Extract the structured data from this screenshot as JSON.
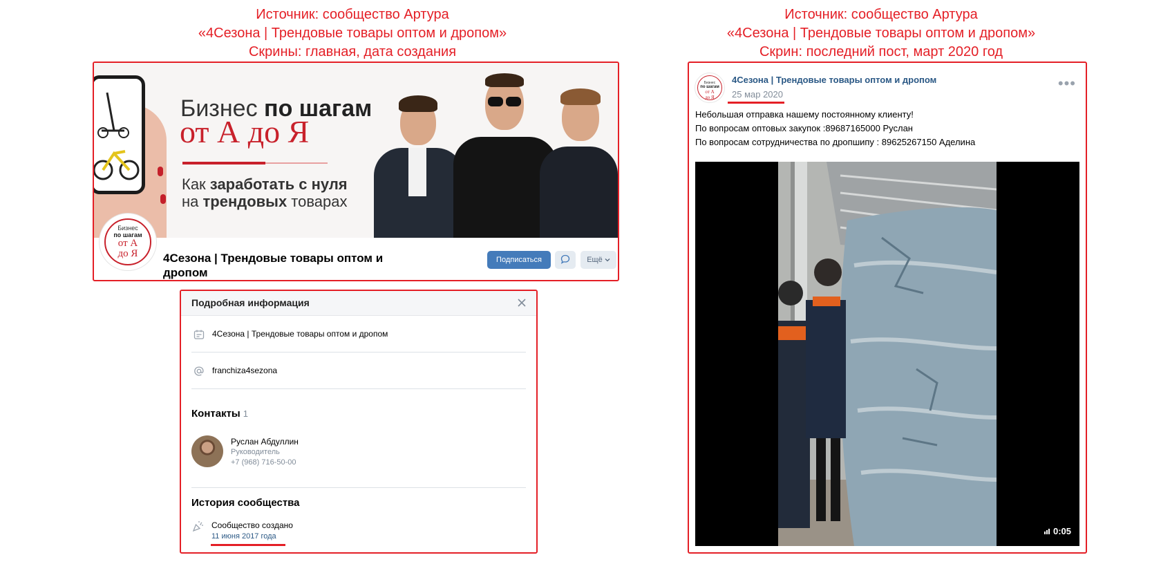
{
  "captions": {
    "left": [
      "Источник: сообщество Артура",
      "«4Сезона | Трендовые товары оптом и дропом»",
      "Скрины: главная, дата создания"
    ],
    "right": [
      "Источник: сообщество Артура",
      "«4Сезона | Трендовые товары оптом и дропом»",
      "Скрин: последний пост,  март 2020 год"
    ]
  },
  "cover": {
    "line1_regular": "Бизнес ",
    "line1_bold": "по шагам",
    "line2": "от А до Я",
    "line3_a": "Как ",
    "line3_b": "заработать с нуля",
    "line4_a": "на ",
    "line4_b": "трендовых",
    "line4_c": " товарах",
    "avatar_l1": "Бизнес",
    "avatar_l2": "по шагам",
    "avatar_l3": "от А",
    "avatar_l4": "до Я"
  },
  "community": {
    "name": "4Сезона | Трендовые товары оптом и дропом",
    "subscribe_label": "Подписаться",
    "more_label": "Ещё"
  },
  "info": {
    "title": "Подробная информация",
    "description": "4Сезона | Трендовые товары оптом и дропом",
    "short_address": "franchiza4sezona",
    "contacts_title": "Контакты",
    "contacts_count": "1",
    "contact": {
      "name": "Руслан Абдуллин",
      "role": "Руководитель",
      "phone": "+7 (968) 716-50-00"
    },
    "history_title": "История сообщества",
    "history_event": "Сообщество создано",
    "history_date": "11 июня 2017 года"
  },
  "post": {
    "author": "4Сезона | Трендовые товары оптом и дропом",
    "date": "25 мар 2020",
    "lines": [
      "Небольшая отправка нашему постоянному клиенту!",
      "По вопросам оптовых закупок :89687165000 Руслан",
      "По вопросам сотрудничества по дропшипу : 89625267150 Аделина"
    ],
    "video_duration": "0:05",
    "avatar_t1": "Бизнес",
    "avatar_t2": "по шагам",
    "avatar_t3": "от А",
    "avatar_t4": "до Я"
  },
  "colors": {
    "accent_red": "#e41f26",
    "vk_blue": "#447bba",
    "link_blue": "#2a5885"
  },
  "icons": [
    "chat-icon",
    "chevron-down-icon",
    "close-icon",
    "description-icon",
    "at-icon",
    "confetti-icon",
    "more-dots-icon",
    "volume-icon"
  ]
}
